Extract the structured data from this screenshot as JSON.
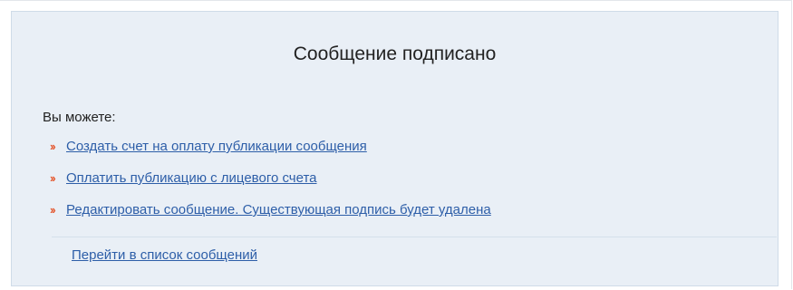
{
  "message_panel": {
    "title": "Сообщение подписано",
    "intro": "Вы можете:",
    "bullet_icon": "double-chevron-right-icon",
    "accent_color": "#e4572e",
    "link_color": "#2d5ea8",
    "actions": [
      {
        "label": "Создать счет на оплату публикации сообщения"
      },
      {
        "label": "Оплатить публикацию с лицевого счета"
      },
      {
        "label": "Редактировать сообщение. Существующая подпись будет удалена"
      }
    ],
    "back_link": "Перейти в список сообщений"
  }
}
